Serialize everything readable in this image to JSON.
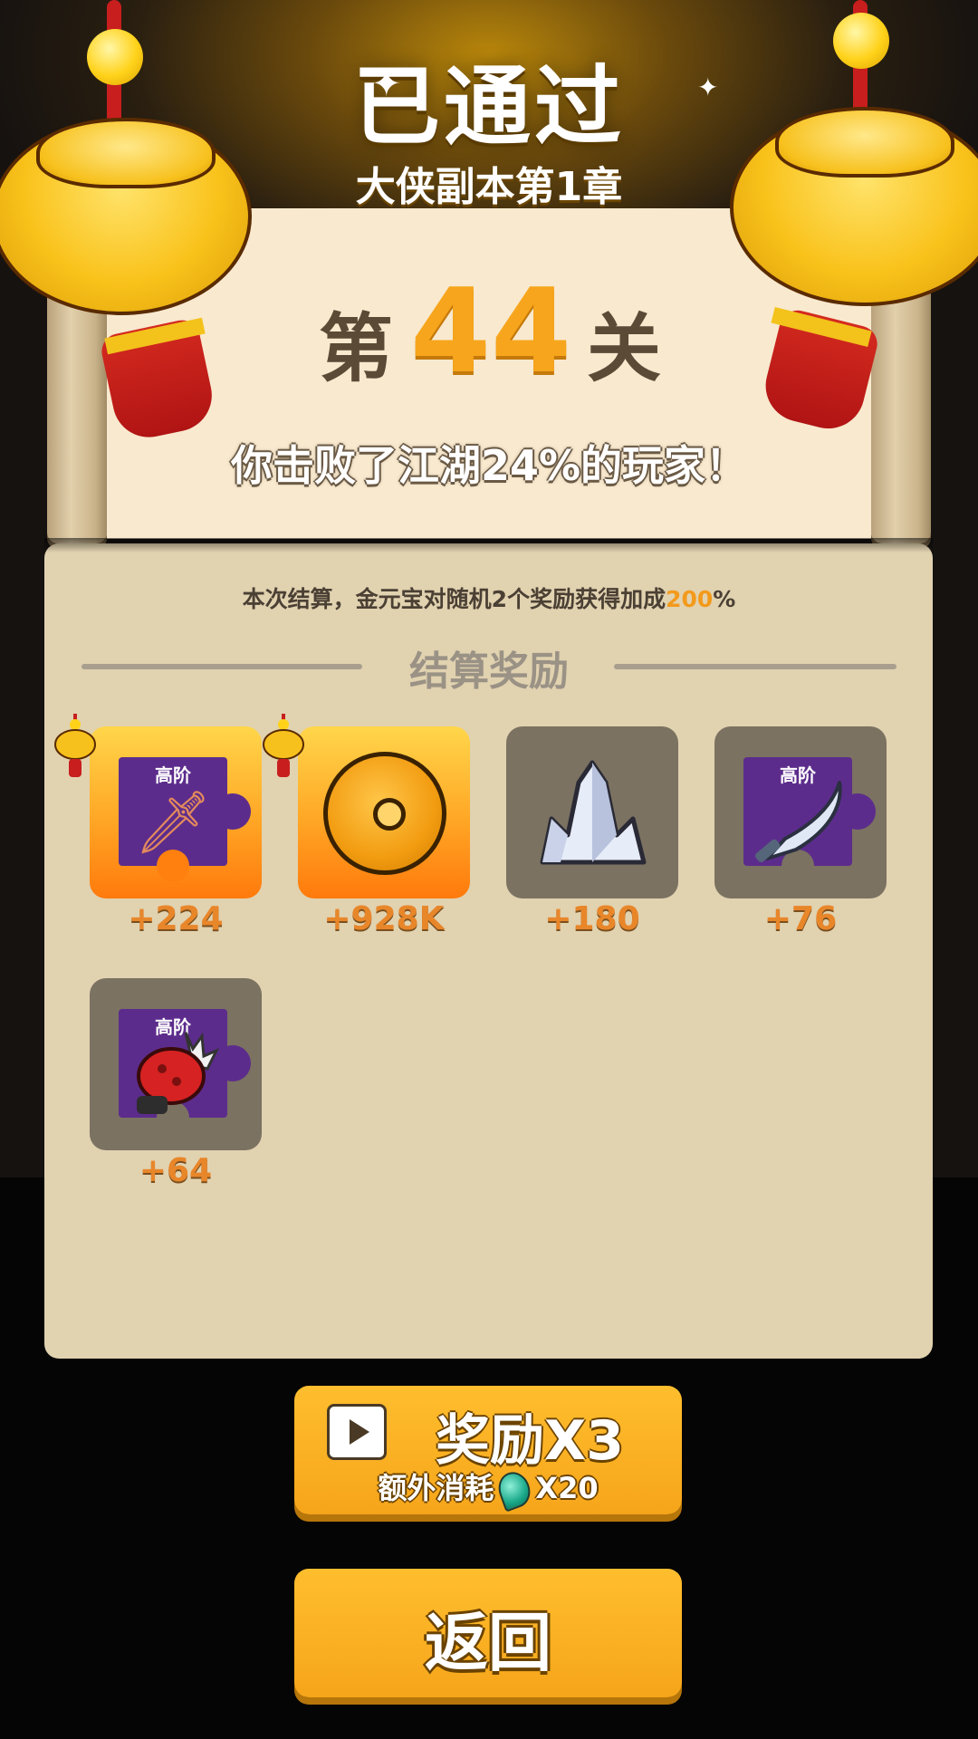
{
  "header": {
    "status_title": "已通过",
    "chapter_name": "大侠副本第1章"
  },
  "level": {
    "prefix": "第",
    "number": "44",
    "suffix": "关"
  },
  "defeat_message": "你击败了江湖24%的玩家！",
  "bonus": {
    "text": "本次结算，金元宝对随机2个奖励获得加成",
    "percent": "200",
    "percent_sign": "%"
  },
  "rewards_section": {
    "title": "结算奖励",
    "items": [
      {
        "tier": "高阶",
        "icon": "sword-fragment-icon",
        "amount": "+224",
        "boosted": true
      },
      {
        "tier": "",
        "icon": "gold-coin-icon",
        "amount": "+928K",
        "boosted": true
      },
      {
        "tier": "",
        "icon": "crystal-icon",
        "amount": "+180",
        "boosted": false
      },
      {
        "tier": "高阶",
        "icon": "saber-fragment-icon",
        "amount": "+76",
        "boosted": false
      },
      {
        "tier": "高阶",
        "icon": "spiked-gauntlet-fragment-icon",
        "amount": "+64",
        "boosted": false
      }
    ]
  },
  "buttons": {
    "triple_reward": {
      "label": "奖励X3",
      "extra_cost_label": "额外消耗",
      "cost_icon": "jade-gem-icon",
      "cost_amount": "X20"
    },
    "back": {
      "label": "返回"
    }
  },
  "colors": {
    "accent_orange": "#f7a51c",
    "amount_orange": "#e8862a",
    "panel": "#e1d2b0",
    "scroll_paper": "#f8e9cf"
  }
}
